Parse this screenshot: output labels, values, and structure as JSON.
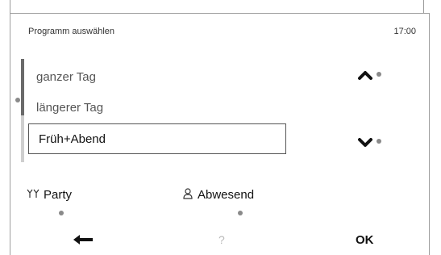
{
  "header": {
    "title": "Programm auswählen",
    "time": "17:00"
  },
  "program_list": {
    "items": [
      {
        "label": "ganzer Tag"
      },
      {
        "label": "längerer Tag"
      },
      {
        "label": "Früh+Abend"
      }
    ]
  },
  "softkeys": {
    "party": {
      "icon": "cocktail-glasses-icon",
      "label": "Party"
    },
    "abwesend": {
      "icon": "person-away-icon",
      "label": "Abwesend"
    }
  },
  "bottom_bar": {
    "back_icon": "back-arrow-icon",
    "help": "?",
    "ok": "OK"
  }
}
